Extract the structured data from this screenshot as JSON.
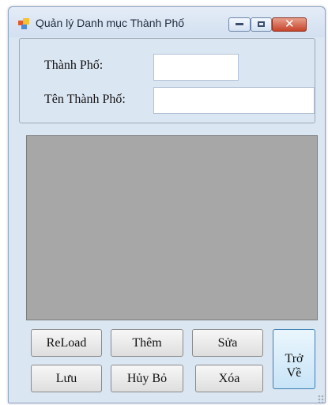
{
  "window": {
    "title": "Quản lý Danh mục Thành Phố",
    "controls": {
      "minimize": "minimize",
      "maximize": "maximize",
      "close": "✕"
    }
  },
  "form": {
    "city_code_label": "Thành Phố:",
    "city_code_value": "",
    "city_name_label": "Tên Thành Phố:",
    "city_name_value": ""
  },
  "buttons": {
    "reload": "ReLoad",
    "add": "Thêm",
    "edit": "Sửa",
    "save": "Lưu",
    "cancel": "Hủy Bỏ",
    "delete": "Xóa",
    "back": "Trở\nVề"
  },
  "colors": {
    "grid_background": "#a7a7a7",
    "window_background": "#dbe6f3",
    "close_button": "#c7432a"
  }
}
